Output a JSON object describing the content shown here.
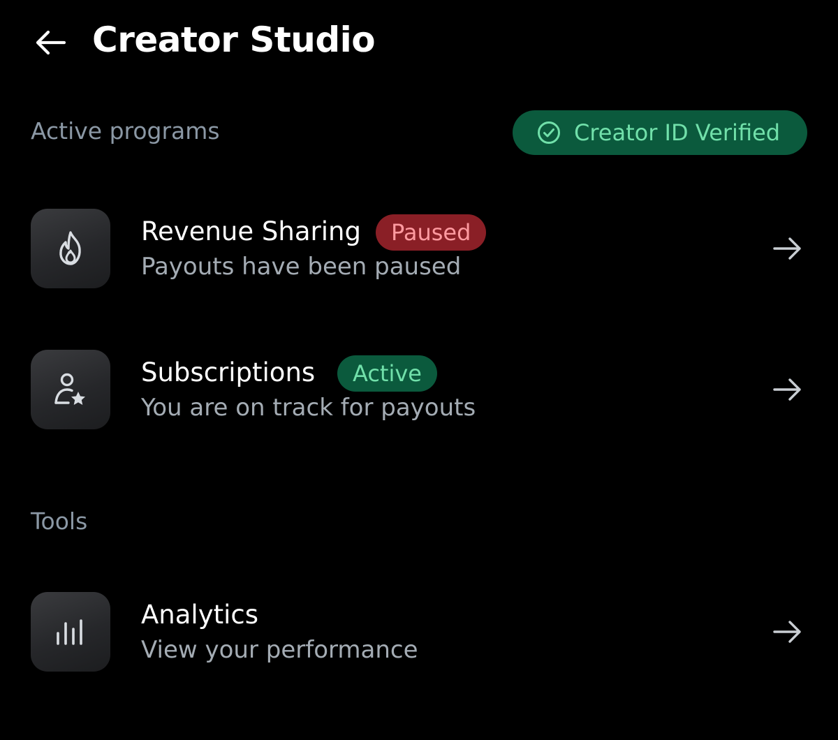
{
  "header": {
    "title": "Creator Studio",
    "back_icon": "back-arrow-icon"
  },
  "active_programs": {
    "heading": "Active programs",
    "verified_label": "Creator ID Verified",
    "verified_icon": "check-circle-icon",
    "verified_color": "#71e0aa",
    "items": [
      {
        "title": "Revenue Sharing",
        "badge": "Paused",
        "subtitle": "Payouts have been paused",
        "icon": "flame-icon",
        "badge_color": "#ff9aa0"
      },
      {
        "title": "Subscriptions",
        "badge": "Active",
        "subtitle": "You are on track for payouts",
        "icon": "user-star-icon",
        "badge_color": "#71e0aa"
      }
    ]
  },
  "tools": {
    "heading": "Tools",
    "items": [
      {
        "title": "Analytics",
        "subtitle": "View your performance",
        "icon": "bar-chart-icon"
      }
    ]
  },
  "colors": {
    "background": "#000000",
    "text_primary": "#ffffff",
    "text_secondary": "#a4acb4",
    "heading": "#8b98a5",
    "success_bg": "#0b5a3d",
    "danger_bg": "#8a1f26"
  }
}
